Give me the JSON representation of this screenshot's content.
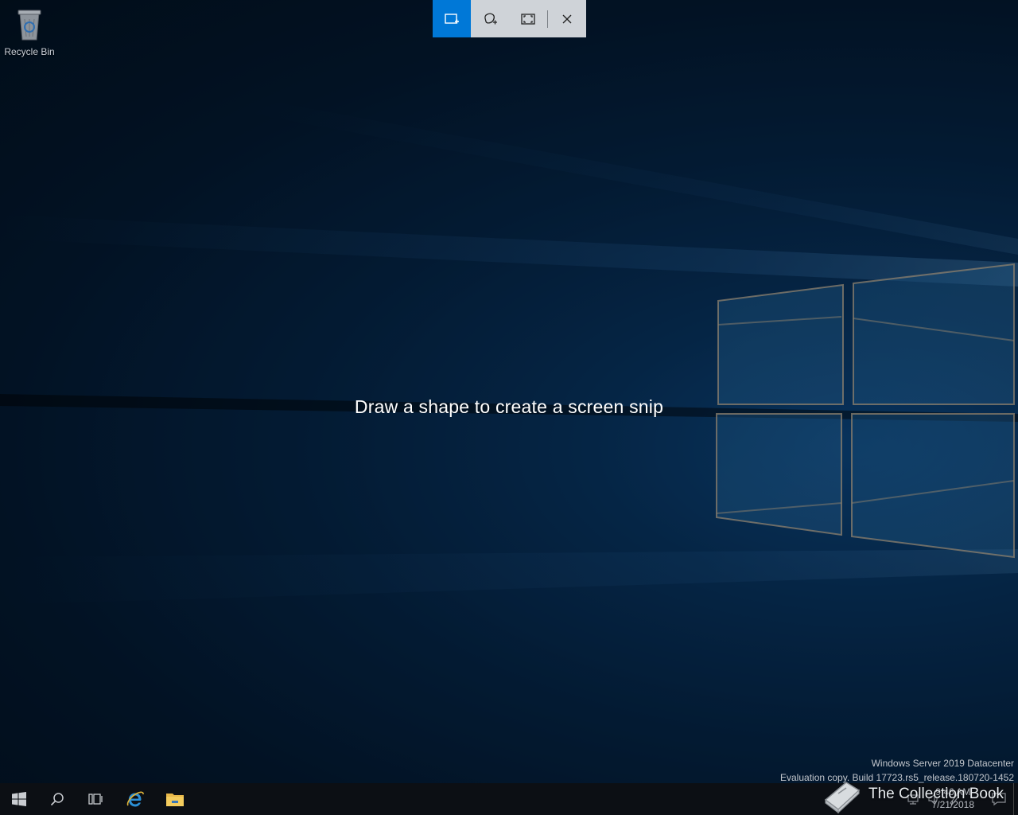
{
  "desktop": {
    "icons": [
      {
        "label": "Recycle Bin",
        "icon": "recycle-bin-icon"
      }
    ]
  },
  "snip_toolbar": {
    "buttons": [
      {
        "name": "rectangular-snip",
        "icon": "rectangle-snip-icon",
        "active": true
      },
      {
        "name": "freeform-snip",
        "icon": "freeform-snip-icon",
        "active": false
      },
      {
        "name": "fullscreen-snip",
        "icon": "fullscreen-snip-icon",
        "active": false
      },
      {
        "name": "close",
        "icon": "close-icon",
        "active": false
      }
    ],
    "accent_color": "#0078d7"
  },
  "snip_message": "Draw a shape to create a screen snip",
  "watermark": {
    "line1": "Windows Server 2019 Datacenter",
    "line2": "Evaluation copy. Build 17723.rs5_release.180720-1452"
  },
  "taskbar": {
    "items": [
      {
        "name": "start",
        "icon": "windows-logo-icon"
      },
      {
        "name": "search",
        "icon": "search-icon"
      },
      {
        "name": "task-view",
        "icon": "task-view-icon"
      },
      {
        "name": "internet-explorer",
        "icon": "internet-explorer-icon"
      },
      {
        "name": "file-explorer",
        "icon": "folder-icon"
      }
    ],
    "tray": {
      "time": "9:46 AM",
      "date": "7/21/2018"
    }
  },
  "overlay_logo": {
    "text": "The Collection Book",
    "icon": "book-icon"
  }
}
